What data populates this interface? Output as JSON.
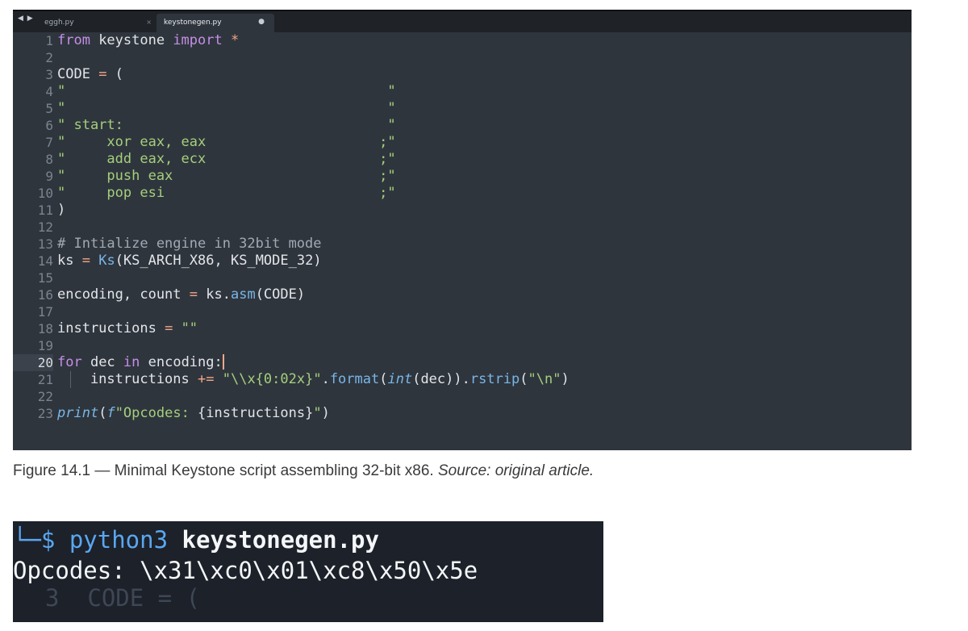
{
  "editor": {
    "nav_arrows": "◀ ▶",
    "tabs": [
      {
        "name": "eggh.py",
        "close": "×",
        "active": false
      },
      {
        "name": "keystonegen.py",
        "dirty_marker": "●",
        "active": true
      }
    ],
    "current_line": 20,
    "lines": [
      {
        "n": "1",
        "tokens": [
          {
            "t": "from",
            "c": "kw"
          },
          {
            "t": " keystone ",
            "c": ""
          },
          {
            "t": "import",
            "c": "kw"
          },
          {
            "t": " ",
            "c": ""
          },
          {
            "t": "*",
            "c": "op"
          }
        ]
      },
      {
        "n": "2",
        "tokens": []
      },
      {
        "n": "3",
        "tokens": [
          {
            "t": "CODE ",
            "c": ""
          },
          {
            "t": "=",
            "c": "op"
          },
          {
            "t": " (",
            "c": ""
          }
        ]
      },
      {
        "n": "4",
        "tokens": [
          {
            "t": "\"                                       \"",
            "c": "str"
          }
        ]
      },
      {
        "n": "5",
        "tokens": [
          {
            "t": "\"                                       \"",
            "c": "str"
          }
        ]
      },
      {
        "n": "6",
        "tokens": [
          {
            "t": "\"",
            "c": "str"
          },
          {
            "t": " start:                                ",
            "c": "str"
          },
          {
            "t": "\"",
            "c": "str"
          }
        ]
      },
      {
        "n": "7",
        "tokens": [
          {
            "t": "\"     xor eax, eax                     ;\"",
            "c": "str"
          }
        ]
      },
      {
        "n": "8",
        "tokens": [
          {
            "t": "\"     add eax, ecx                     ;\"",
            "c": "str"
          }
        ]
      },
      {
        "n": "9",
        "tokens": [
          {
            "t": "\"     push eax                         ;\"",
            "c": "str"
          }
        ]
      },
      {
        "n": "10",
        "tokens": [
          {
            "t": "\"     pop esi                          ;\"",
            "c": "str"
          }
        ]
      },
      {
        "n": "11",
        "tokens": [
          {
            "t": ")",
            "c": ""
          }
        ]
      },
      {
        "n": "12",
        "tokens": []
      },
      {
        "n": "13",
        "tokens": [
          {
            "t": "# Intialize engine in 32bit mode",
            "c": "cm"
          }
        ]
      },
      {
        "n": "14",
        "tokens": [
          {
            "t": "ks ",
            "c": ""
          },
          {
            "t": "=",
            "c": "op"
          },
          {
            "t": " ",
            "c": ""
          },
          {
            "t": "Ks",
            "c": "fn"
          },
          {
            "t": "(KS_ARCH_X86, KS_MODE_32)",
            "c": ""
          }
        ]
      },
      {
        "n": "15",
        "tokens": []
      },
      {
        "n": "16",
        "tokens": [
          {
            "t": "encoding, count ",
            "c": ""
          },
          {
            "t": "=",
            "c": "op"
          },
          {
            "t": " ks.",
            "c": ""
          },
          {
            "t": "asm",
            "c": "fn"
          },
          {
            "t": "(CODE)",
            "c": ""
          }
        ]
      },
      {
        "n": "17",
        "tokens": []
      },
      {
        "n": "18",
        "tokens": [
          {
            "t": "instructions ",
            "c": ""
          },
          {
            "t": "=",
            "c": "op"
          },
          {
            "t": " ",
            "c": ""
          },
          {
            "t": "\"\"",
            "c": "str"
          }
        ]
      },
      {
        "n": "19",
        "tokens": []
      },
      {
        "n": "20",
        "tokens": [
          {
            "t": "for",
            "c": "kw"
          },
          {
            "t": " dec ",
            "c": ""
          },
          {
            "t": "in",
            "c": "kw"
          },
          {
            "t": " encoding:",
            "c": ""
          }
        ]
      },
      {
        "n": "21",
        "tokens": [
          {
            "t": "    instructions ",
            "c": ""
          },
          {
            "t": "+=",
            "c": "op"
          },
          {
            "t": " ",
            "c": ""
          },
          {
            "t": "\"\\\\x{0:02x}\"",
            "c": "str"
          },
          {
            "t": ".",
            "c": ""
          },
          {
            "t": "format",
            "c": "fn"
          },
          {
            "t": "(",
            "c": ""
          },
          {
            "t": "int",
            "c": "ital"
          },
          {
            "t": "(dec)).",
            "c": ""
          },
          {
            "t": "rstrip",
            "c": "fn"
          },
          {
            "t": "(",
            "c": ""
          },
          {
            "t": "\"\\n\"",
            "c": "str"
          },
          {
            "t": ")",
            "c": ""
          }
        ]
      },
      {
        "n": "22",
        "tokens": []
      },
      {
        "n": "23",
        "tokens": [
          {
            "t": "print",
            "c": "ital"
          },
          {
            "t": "(",
            "c": ""
          },
          {
            "t": "f",
            "c": "ital"
          },
          {
            "t": "\"Opcodes: ",
            "c": "str"
          },
          {
            "t": "{instructions}",
            "c": ""
          },
          {
            "t": "\"",
            "c": "str"
          },
          {
            "t": ")",
            "c": ""
          }
        ]
      }
    ]
  },
  "caption": {
    "text": "Figure 14.1 — Minimal Keystone script assembling 32-bit x86. ",
    "source": "Source: original article."
  },
  "terminal": {
    "prompt": "└─$ ",
    "command_program": "python3 ",
    "command_file": "keystonegen.py",
    "output": "Opcodes: \\x31\\xc0\\x01\\xc8\\x50\\x5e",
    "ghost_text": "3  CODE = ("
  }
}
